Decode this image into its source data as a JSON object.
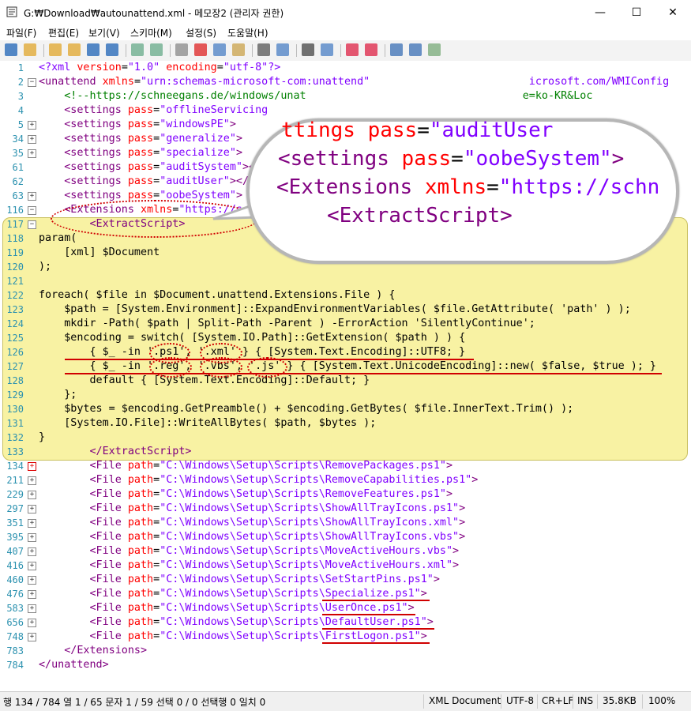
{
  "window": {
    "title": "G:₩Download₩autounattend.xml - 메모장2 (관리자 권한)",
    "minimize": "—",
    "maximize": "☐",
    "close": "✕"
  },
  "menu": [
    "파일(F)",
    "편집(E)",
    "보기(V)",
    "스키마(M)",
    "설정(S)",
    "도움말(H)"
  ],
  "toolbar": {
    "icons": [
      "new-icon",
      "open-icon",
      "browse-icon",
      "reopen-icon",
      "save-icon",
      "saveas-icon",
      "undo-icon",
      "redo-icon",
      "cut-icon",
      "delete-icon",
      "copy-icon",
      "paste-icon",
      "find-icon",
      "replace-icon",
      "wordwrap-icon",
      "lineno-icon",
      "zoomin-icon",
      "zoomout-icon",
      "schema-icon",
      "settings-icon",
      "exit-icon"
    ]
  },
  "lines": [
    {
      "n": "1",
      "fold": "",
      "segs": [
        [
          "pi",
          "<?xml "
        ],
        [
          "attr",
          "version"
        ],
        [
          "txt",
          "="
        ],
        [
          "val",
          "\"1.0\" "
        ],
        [
          "attr",
          "encoding"
        ],
        [
          "txt",
          "="
        ],
        [
          "val",
          "\"utf-8\""
        ],
        [
          "pi",
          "?>"
        ]
      ]
    },
    {
      "n": "2",
      "fold": "-",
      "segs": [
        [
          "tag",
          "<unattend "
        ],
        [
          "attr",
          "xmlns"
        ],
        [
          "txt",
          "="
        ],
        [
          "val",
          "\"urn:schemas-microsoft-com:unattend\""
        ],
        [
          "txt",
          "                         "
        ],
        [
          "val",
          "icrosoft.com/WMIConfig"
        ]
      ]
    },
    {
      "n": "3",
      "fold": "",
      "segs": [
        [
          "txt",
          "    "
        ],
        [
          "com",
          "<!--https://schneegans.de/windows/unat"
        ],
        [
          "txt",
          "                                  "
        ],
        [
          "com",
          "e=ko-KR&Loc"
        ]
      ]
    },
    {
      "n": "4",
      "fold": "",
      "segs": [
        [
          "txt",
          "    "
        ],
        [
          "tag",
          "<settings "
        ],
        [
          "attr",
          "pass"
        ],
        [
          "txt",
          "="
        ],
        [
          "val",
          "\"offlineServicing"
        ]
      ]
    },
    {
      "n": "5",
      "fold": "+",
      "segs": [
        [
          "txt",
          "    "
        ],
        [
          "tag",
          "<settings "
        ],
        [
          "attr",
          "pass"
        ],
        [
          "txt",
          "="
        ],
        [
          "val",
          "\"windowsPE\""
        ],
        [
          "tag",
          ">"
        ]
      ]
    },
    {
      "n": "34",
      "fold": "+",
      "segs": [
        [
          "txt",
          "    "
        ],
        [
          "tag",
          "<settings "
        ],
        [
          "attr",
          "pass"
        ],
        [
          "txt",
          "="
        ],
        [
          "val",
          "\"generalize\""
        ],
        [
          "tag",
          ">"
        ]
      ]
    },
    {
      "n": "35",
      "fold": "+",
      "segs": [
        [
          "txt",
          "    "
        ],
        [
          "tag",
          "<settings "
        ],
        [
          "attr",
          "pass"
        ],
        [
          "txt",
          "="
        ],
        [
          "val",
          "\"specialize\""
        ],
        [
          "tag",
          ">"
        ]
      ]
    },
    {
      "n": "61",
      "fold": "",
      "segs": [
        [
          "txt",
          "    "
        ],
        [
          "tag",
          "<settings "
        ],
        [
          "attr",
          "pass"
        ],
        [
          "txt",
          "="
        ],
        [
          "val",
          "\"auditSystem\""
        ],
        [
          "tag",
          "></"
        ]
      ]
    },
    {
      "n": "62",
      "fold": "",
      "segs": [
        [
          "txt",
          "    "
        ],
        [
          "tag",
          "<settings "
        ],
        [
          "attr",
          "pass"
        ],
        [
          "txt",
          "="
        ],
        [
          "val",
          "\"auditUser\""
        ],
        [
          "tag",
          "></"
        ]
      ]
    },
    {
      "n": "63",
      "fold": "+",
      "segs": [
        [
          "txt",
          "    "
        ],
        [
          "tag",
          "<settings "
        ],
        [
          "attr",
          "pass"
        ],
        [
          "txt",
          "="
        ],
        [
          "val",
          "\"oobeSystem\""
        ],
        [
          "tag",
          ">"
        ]
      ]
    },
    {
      "n": "116",
      "fold": "-",
      "segs": [
        [
          "txt",
          "    "
        ],
        [
          "tag",
          "<Extensions "
        ],
        [
          "attr",
          "xmlns"
        ],
        [
          "txt",
          "="
        ],
        [
          "val",
          "\"https://schneegans.de/windows/unattend-generator/\""
        ],
        [
          "tag",
          ">"
        ]
      ]
    },
    {
      "n": "117",
      "fold": "-",
      "segs": [
        [
          "txt",
          "        "
        ],
        [
          "tag",
          "<ExtractScript>"
        ]
      ]
    },
    {
      "n": "118",
      "fold": "",
      "segs": [
        [
          "txt",
          "param("
        ]
      ]
    },
    {
      "n": "119",
      "fold": "",
      "segs": [
        [
          "txt",
          "    [xml] $Document"
        ]
      ]
    },
    {
      "n": "120",
      "fold": "",
      "segs": [
        [
          "txt",
          ");"
        ]
      ]
    },
    {
      "n": "121",
      "fold": "",
      "segs": [
        [
          "txt",
          ""
        ]
      ]
    },
    {
      "n": "122",
      "fold": "",
      "segs": [
        [
          "txt",
          "foreach( $file in $Document.unattend.Extensions.File ) {"
        ]
      ]
    },
    {
      "n": "123",
      "fold": "",
      "segs": [
        [
          "txt",
          "    $path = [System.Environment]::ExpandEnvironmentVariables( $file.GetAttribute( 'path' ) );"
        ]
      ]
    },
    {
      "n": "124",
      "fold": "",
      "segs": [
        [
          "txt",
          "    mkdir -Path( $path | Split-Path -Parent ) -ErrorAction 'SilentlyContinue';"
        ]
      ]
    },
    {
      "n": "125",
      "fold": "",
      "segs": [
        [
          "txt",
          "    $encoding = switch( [System.IO.Path]::GetExtension( $path ) ) {"
        ]
      ]
    },
    {
      "n": "126",
      "fold": "",
      "segs": [
        [
          "txt",
          "        { $_ -in '.ps1', '.xml' } { [System.Text.Encoding]::UTF8; }"
        ]
      ]
    },
    {
      "n": "127",
      "fold": "",
      "segs": [
        [
          "txt",
          "        { $_ -in '.reg', '.vbs', '.js' } { [System.Text.UnicodeEncoding]::new( $false, $true ); }"
        ]
      ]
    },
    {
      "n": "128",
      "fold": "",
      "segs": [
        [
          "txt",
          "        default { [System.Text.Encoding]::Default; }"
        ]
      ]
    },
    {
      "n": "129",
      "fold": "",
      "segs": [
        [
          "txt",
          "    };"
        ]
      ]
    },
    {
      "n": "130",
      "fold": "",
      "segs": [
        [
          "txt",
          "    $bytes = $encoding.GetPreamble() + $encoding.GetBytes( $file.InnerText.Trim() );"
        ]
      ]
    },
    {
      "n": "131",
      "fold": "",
      "segs": [
        [
          "txt",
          "    [System.IO.File]::WriteAllBytes( $path, $bytes );"
        ]
      ]
    },
    {
      "n": "132",
      "fold": "",
      "segs": [
        [
          "txt",
          "}"
        ]
      ]
    },
    {
      "n": "133",
      "fold": "",
      "segs": [
        [
          "txt",
          "        "
        ],
        [
          "tag",
          "</ExtractScript>"
        ]
      ]
    },
    {
      "n": "134",
      "fold": "+r",
      "segs": [
        [
          "txt",
          "        "
        ],
        [
          "tag",
          "<File "
        ],
        [
          "attr",
          "path"
        ],
        [
          "txt",
          "="
        ],
        [
          "val",
          "\"C:\\Windows\\Setup\\Scripts\\RemovePackages.ps1\""
        ],
        [
          "tag",
          ">"
        ]
      ]
    },
    {
      "n": "211",
      "fold": "+",
      "segs": [
        [
          "txt",
          "        "
        ],
        [
          "tag",
          "<File "
        ],
        [
          "attr",
          "path"
        ],
        [
          "txt",
          "="
        ],
        [
          "val",
          "\"C:\\Windows\\Setup\\Scripts\\RemoveCapabilities.ps1\""
        ],
        [
          "tag",
          ">"
        ]
      ]
    },
    {
      "n": "229",
      "fold": "+",
      "segs": [
        [
          "txt",
          "        "
        ],
        [
          "tag",
          "<File "
        ],
        [
          "attr",
          "path"
        ],
        [
          "txt",
          "="
        ],
        [
          "val",
          "\"C:\\Windows\\Setup\\Scripts\\RemoveFeatures.ps1\""
        ],
        [
          "tag",
          ">"
        ]
      ]
    },
    {
      "n": "297",
      "fold": "+",
      "segs": [
        [
          "txt",
          "        "
        ],
        [
          "tag",
          "<File "
        ],
        [
          "attr",
          "path"
        ],
        [
          "txt",
          "="
        ],
        [
          "val",
          "\"C:\\Windows\\Setup\\Scripts\\ShowAllTrayIcons.ps1\""
        ],
        [
          "tag",
          ">"
        ]
      ]
    },
    {
      "n": "351",
      "fold": "+",
      "segs": [
        [
          "txt",
          "        "
        ],
        [
          "tag",
          "<File "
        ],
        [
          "attr",
          "path"
        ],
        [
          "txt",
          "="
        ],
        [
          "val",
          "\"C:\\Windows\\Setup\\Scripts\\ShowAllTrayIcons.xml\""
        ],
        [
          "tag",
          ">"
        ]
      ]
    },
    {
      "n": "395",
      "fold": "+",
      "segs": [
        [
          "txt",
          "        "
        ],
        [
          "tag",
          "<File "
        ],
        [
          "attr",
          "path"
        ],
        [
          "txt",
          "="
        ],
        [
          "val",
          "\"C:\\Windows\\Setup\\Scripts\\ShowAllTrayIcons.vbs\""
        ],
        [
          "tag",
          ">"
        ]
      ]
    },
    {
      "n": "407",
      "fold": "+",
      "segs": [
        [
          "txt",
          "        "
        ],
        [
          "tag",
          "<File "
        ],
        [
          "attr",
          "path"
        ],
        [
          "txt",
          "="
        ],
        [
          "val",
          "\"C:\\Windows\\Setup\\Scripts\\MoveActiveHours.vbs\""
        ],
        [
          "tag",
          ">"
        ]
      ]
    },
    {
      "n": "416",
      "fold": "+",
      "segs": [
        [
          "txt",
          "        "
        ],
        [
          "tag",
          "<File "
        ],
        [
          "attr",
          "path"
        ],
        [
          "txt",
          "="
        ],
        [
          "val",
          "\"C:\\Windows\\Setup\\Scripts\\MoveActiveHours.xml\""
        ],
        [
          "tag",
          ">"
        ]
      ]
    },
    {
      "n": "460",
      "fold": "+",
      "segs": [
        [
          "txt",
          "        "
        ],
        [
          "tag",
          "<File "
        ],
        [
          "attr",
          "path"
        ],
        [
          "txt",
          "="
        ],
        [
          "val",
          "\"C:\\Windows\\Setup\\Scripts\\SetStartPins.ps1\""
        ],
        [
          "tag",
          ">"
        ]
      ]
    },
    {
      "n": "476",
      "fold": "+",
      "segs": [
        [
          "txt",
          "        "
        ],
        [
          "tag",
          "<File "
        ],
        [
          "attr",
          "path"
        ],
        [
          "txt",
          "="
        ],
        [
          "val",
          "\"C:\\Windows\\Setup\\Scripts\\Specialize.ps1\""
        ],
        [
          "tag",
          ">"
        ]
      ]
    },
    {
      "n": "583",
      "fold": "+",
      "segs": [
        [
          "txt",
          "        "
        ],
        [
          "tag",
          "<File "
        ],
        [
          "attr",
          "path"
        ],
        [
          "txt",
          "="
        ],
        [
          "val",
          "\"C:\\Windows\\Setup\\Scripts\\UserOnce.ps1\""
        ],
        [
          "tag",
          ">"
        ]
      ]
    },
    {
      "n": "656",
      "fold": "+",
      "segs": [
        [
          "txt",
          "        "
        ],
        [
          "tag",
          "<File "
        ],
        [
          "attr",
          "path"
        ],
        [
          "txt",
          "="
        ],
        [
          "val",
          "\"C:\\Windows\\Setup\\Scripts\\DefaultUser.ps1\""
        ],
        [
          "tag",
          ">"
        ]
      ]
    },
    {
      "n": "748",
      "fold": "+",
      "segs": [
        [
          "txt",
          "        "
        ],
        [
          "tag",
          "<File "
        ],
        [
          "attr",
          "path"
        ],
        [
          "txt",
          "="
        ],
        [
          "val",
          "\"C:\\Windows\\Setup\\Scripts\\FirstLogon.ps1\""
        ],
        [
          "tag",
          ">"
        ]
      ]
    },
    {
      "n": "783",
      "fold": "",
      "segs": [
        [
          "txt",
          "    "
        ],
        [
          "tag",
          "</Extensions>"
        ]
      ]
    },
    {
      "n": "784",
      "fold": "",
      "segs": [
        [
          "tag",
          "</unattend>"
        ]
      ]
    }
  ],
  "zoom": {
    "line1": [
      [
        "attr",
        "ttings "
      ],
      [
        "attr2",
        "pass"
      ],
      [
        "txt",
        "="
      ],
      [
        "val",
        "\"auditUser"
      ]
    ],
    "line2": [
      [
        "tag",
        "<settings "
      ],
      [
        "attr2",
        "pass"
      ],
      [
        "txt",
        "="
      ],
      [
        "val",
        "\"oobeSystem\""
      ],
      [
        "tag",
        ">"
      ]
    ],
    "line3": [
      [
        "tag",
        "<Extensions "
      ],
      [
        "attr2",
        "xmlns"
      ],
      [
        "txt",
        "="
      ],
      [
        "val",
        "\"https://schn"
      ]
    ],
    "line4": [
      [
        "tag",
        "<ExtractScript>"
      ]
    ]
  },
  "status": {
    "position": "행 134 / 784  열 1 / 65  문자 1 / 59  선택 0 / 0  선택행 0  일치 0",
    "scheme": "XML Document",
    "encoding": "UTF-8",
    "eol": "CR+LF",
    "ins": "INS",
    "size": "35.8KB",
    "zoom": "100%"
  },
  "colors": {
    "tag": "#800080",
    "attr": "#ff0000",
    "value": "#8000ff",
    "comment": "#008000",
    "highlight": "#f8f2a3",
    "annotation": "#d00000",
    "linenumber": "#2b91af"
  }
}
